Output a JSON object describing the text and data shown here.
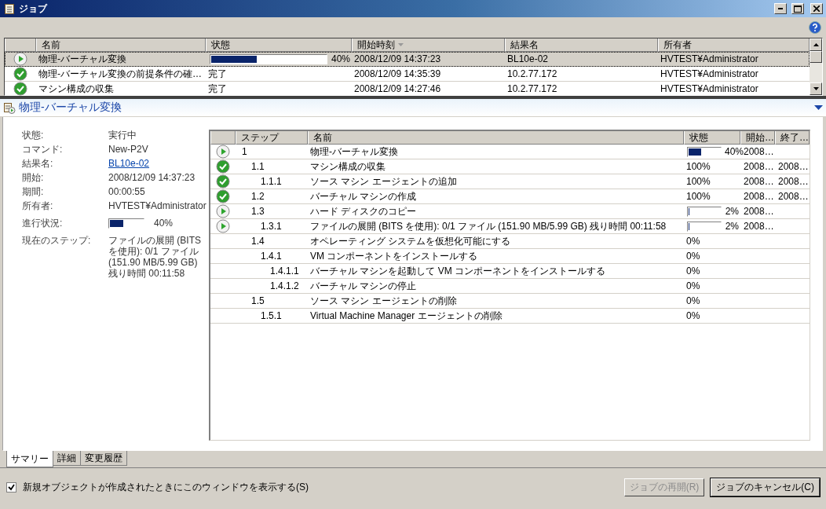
{
  "window": {
    "title": "ジョブ"
  },
  "jobs": {
    "columns": [
      "名前",
      "状態",
      "開始時刻",
      "結果名",
      "所有者"
    ],
    "rows": [
      {
        "kind": "running",
        "name": "物理-バーチャル変換",
        "status": {
          "kind": "progress",
          "level": 0.4,
          "reading": "40%"
        },
        "start": "2008/12/09 14:37:23",
        "result": "BL10e-02",
        "owner": "HVTEST¥Administrator",
        "selected": true
      },
      {
        "kind": "done",
        "name": "物理-バーチャル変換の前提条件の確…",
        "status": {
          "kind": "text",
          "reading": "完了"
        },
        "start": "2008/12/09 14:35:39",
        "result": "10.2.77.172",
        "owner": "HVTEST¥Administrator",
        "selected": false
      },
      {
        "kind": "done",
        "name": "マシン構成の収集",
        "status": {
          "kind": "text",
          "reading": "完了"
        },
        "start": "2008/12/09 14:27:46",
        "result": "10.2.77.172",
        "owner": "HVTEST¥Administrator",
        "selected": false
      }
    ]
  },
  "detail": {
    "title": "物理-バーチャル変換",
    "summary": [
      {
        "label": "状態:",
        "kind": "text",
        "value": "実行中"
      },
      {
        "label": "コマンド:",
        "kind": "text",
        "value": "New-P2V"
      },
      {
        "label": "結果名:",
        "kind": "link",
        "value": "BL10e-02"
      },
      {
        "label": "開始:",
        "kind": "text",
        "value": "2008/12/09 14:37:23"
      },
      {
        "label": "期間:",
        "kind": "text",
        "value": "00:00:55"
      },
      {
        "label": "所有者:",
        "kind": "text",
        "value": "HVTEST¥Administrator"
      },
      {
        "label": "進行状況:",
        "kind": "progress",
        "level": 0.4,
        "value": "40%"
      },
      {
        "label": "現在のステップ:",
        "kind": "text",
        "value": "ファイルの展開 (BITS を使用): 0/1 ファイル (151.90 MB/5.99 GB) 残り時間 00:11:58"
      }
    ],
    "steps": {
      "columns": [
        "ステップ",
        "名前",
        "状態",
        "開始…",
        "終了…"
      ],
      "rows": [
        {
          "kind": "running",
          "step": "1",
          "name": "物理-バーチャル変換",
          "status": {
            "kind": "progress",
            "level": 0.4,
            "reading": "40%"
          },
          "start": "2008…",
          "children": [
            {
              "kind": "done",
              "step": "1.1",
              "name": "マシン構成の収集",
              "status": {
                "kind": "text",
                "reading": "100%"
              },
              "start": "2008…",
              "end": "2008…",
              "children": [
                {
                  "kind": "done",
                  "step": "1.1.1",
                  "name": "ソース マシン エージェントの追加",
                  "status": {
                    "kind": "text",
                    "reading": "100%"
                  },
                  "start": "2008…",
                  "end": "2008…"
                }
              ]
            },
            {
              "kind": "done",
              "step": "1.2",
              "name": "バーチャル マシンの作成",
              "status": {
                "kind": "text",
                "reading": "100%"
              },
              "start": "2008…",
              "end": "2008…"
            },
            {
              "kind": "running",
              "step": "1.3",
              "name": "ハード ディスクのコピー",
              "status": {
                "kind": "progress",
                "level": 0.02,
                "reading": "2%"
              },
              "start": "2008…",
              "children": [
                {
                  "kind": "running",
                  "step": "1.3.1",
                  "name": "ファイルの展開 (BITS を使用): 0/1 ファイル (151.90 MB/5.99 GB) 残り時間 00:11:58",
                  "status": {
                    "kind": "progress",
                    "level": 0.02,
                    "reading": "2%"
                  },
                  "start": "2008…"
                }
              ]
            },
            {
              "step": "1.4",
              "name": "オペレーティング システムを仮想化可能にする",
              "status": {
                "kind": "text",
                "reading": "0%"
              },
              "children": [
                {
                  "step": "1.4.1",
                  "name": "VM コンポーネントをインストールする",
                  "status": {
                    "kind": "text",
                    "reading": "0%"
                  },
                  "children": [
                    {
                      "step": "1.4.1.1",
                      "name": "バーチャル マシンを起動して VM コンポーネントをインストールする",
                      "status": {
                        "kind": "text",
                        "reading": "0%"
                      }
                    },
                    {
                      "step": "1.4.1.2",
                      "name": "バーチャル マシンの停止",
                      "status": {
                        "kind": "text",
                        "reading": "0%"
                      }
                    }
                  ]
                }
              ]
            },
            {
              "step": "1.5",
              "name": "ソース マシン エージェントの削除",
              "status": {
                "kind": "text",
                "reading": "0%"
              },
              "children": [
                {
                  "step": "1.5.1",
                  "name": "Virtual Machine Manager エージェントの削除",
                  "status": {
                    "kind": "text",
                    "reading": "0%"
                  }
                }
              ]
            }
          ]
        }
      ]
    }
  },
  "tabs": [
    {
      "label": "サマリー",
      "selected": true
    },
    {
      "label": "詳細",
      "selected": false
    },
    {
      "label": "変更履歴",
      "selected": false
    }
  ],
  "show_window": {
    "label": "新規オブジェクトが作成されたときにこのウィンドウを表示する(S)",
    "checked": true
  },
  "buttons": [
    {
      "label": "ジョブの再開(R)",
      "disabled": true
    },
    {
      "label": "ジョブのキャンセル(C)",
      "disabled": false
    }
  ]
}
